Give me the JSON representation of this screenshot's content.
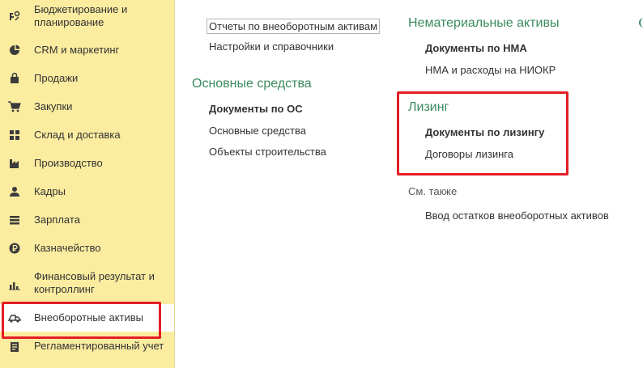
{
  "sidebar": {
    "items": [
      {
        "label": "Бюджетирование и планирование",
        "icon": "budget-icon"
      },
      {
        "label": "CRM и маркетинг",
        "icon": "pie-chart-icon"
      },
      {
        "label": "Продажи",
        "icon": "shopping-bag-icon"
      },
      {
        "label": "Закупки",
        "icon": "cart-icon"
      },
      {
        "label": "Склад и доставка",
        "icon": "warehouse-grid-icon"
      },
      {
        "label": "Производство",
        "icon": "factory-icon"
      },
      {
        "label": "Кадры",
        "icon": "person-icon"
      },
      {
        "label": "Зарплата",
        "icon": "salary-icon"
      },
      {
        "label": "Казначейство",
        "icon": "ruble-coin-icon"
      },
      {
        "label": "Финансовый результат и контроллинг",
        "icon": "bar-chart-icon"
      },
      {
        "label": "Внеоборотные активы",
        "icon": "truck-icon"
      },
      {
        "label": "Регламентированный учет",
        "icon": "document-list-icon"
      }
    ],
    "active_index": 10
  },
  "col1": {
    "top_links": [
      "Отчеты по внеоборотным активам",
      "Настройки и справочники"
    ],
    "os_title": "Основные средства",
    "os_bold": "Документы по ОС",
    "os_links": [
      "Основные средства",
      "Объекты строительства"
    ]
  },
  "col2": {
    "nma_title": "Нематериальные активы",
    "nma_bold": "Документы по НМА",
    "nma_link": "НМА и расходы на НИОКР",
    "lease_title": "Лизинг",
    "lease_bold": "Документы по лизингу",
    "lease_link": "Договоры лизинга",
    "see_also": "См. также",
    "see_also_link": "Ввод остатков внеоборотных активов"
  },
  "colors": {
    "sidebar_bg": "#fbeca0",
    "section_title": "#3a8a5f",
    "highlight_red": "#e41e26"
  }
}
